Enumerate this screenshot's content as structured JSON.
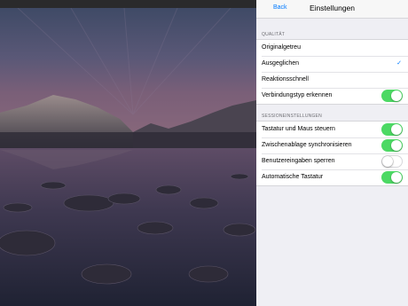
{
  "nav": {
    "back_label": "Back",
    "title": "Einstellungen"
  },
  "quality": {
    "header": "QUALITÄT",
    "options": [
      {
        "label": "Originalgetreu",
        "checked": false
      },
      {
        "label": "Ausgeglichen",
        "checked": true
      },
      {
        "label": "Reaktionsschnell",
        "checked": false
      }
    ],
    "detect": {
      "label": "Verbindungstyp erkennen",
      "on": true
    }
  },
  "session": {
    "header": "SESSIONEINSTELLUNGEN",
    "toggles": [
      {
        "label": "Tastatur und Maus steuern",
        "on": true
      },
      {
        "label": "Zwischenablage synchronisieren",
        "on": true
      },
      {
        "label": "Benutzereingaben sperren",
        "on": false
      },
      {
        "label": "Automatische Tastatur",
        "on": true
      }
    ]
  },
  "colors": {
    "accent": "#007aff",
    "switch_on": "#4cd964"
  }
}
